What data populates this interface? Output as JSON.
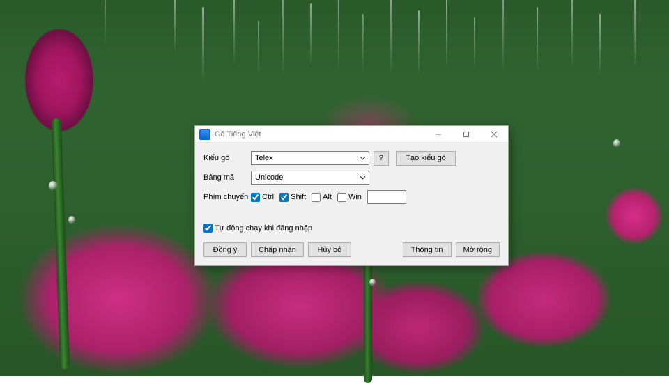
{
  "dialog": {
    "title": "Gõ Tiếng Việt",
    "labels": {
      "kieu_go": "Kiểu gõ",
      "bang_ma": "Bảng mã",
      "phim_chuyen": "Phím chuyển"
    },
    "selects": {
      "kieu_go_value": "Telex",
      "bang_ma_value": "Unicode"
    },
    "buttons": {
      "question": "?",
      "tao_kieu_go": "Tạo kiểu gõ",
      "dong_y": "Đồng ý",
      "chap_nhan": "Chấp nhận",
      "huy_bo": "Hủy bỏ",
      "thong_tin": "Thông tin",
      "mo_rong": "Mở rộng"
    },
    "checkboxes": {
      "ctrl": {
        "label": "Ctrl",
        "checked": true
      },
      "shift": {
        "label": "Shift",
        "checked": true
      },
      "alt": {
        "label": "Alt",
        "checked": false
      },
      "win": {
        "label": "Win",
        "checked": false
      },
      "autorun": {
        "label": "Tự động chạy khi đăng nhập",
        "checked": true
      }
    },
    "hotkey_text": ""
  }
}
